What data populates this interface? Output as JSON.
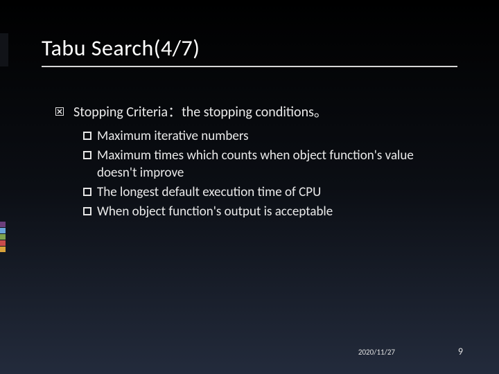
{
  "title": "Tabu Search(4/7)",
  "main_point": "Stopping Criteria：the stopping conditions。",
  "sub_items": [
    "Maximum iterative numbers",
    "Maximum times which counts when object function's value doesn't improve",
    "The longest default execution time of CPU",
    "When object function's output is acceptable"
  ],
  "footer": {
    "date": "2020/11/27",
    "page": "9"
  },
  "accent_colors": [
    "#6b3e7a",
    "#6aa4d9",
    "#7fa24e",
    "#c94b4b",
    "#d8a23a"
  ]
}
